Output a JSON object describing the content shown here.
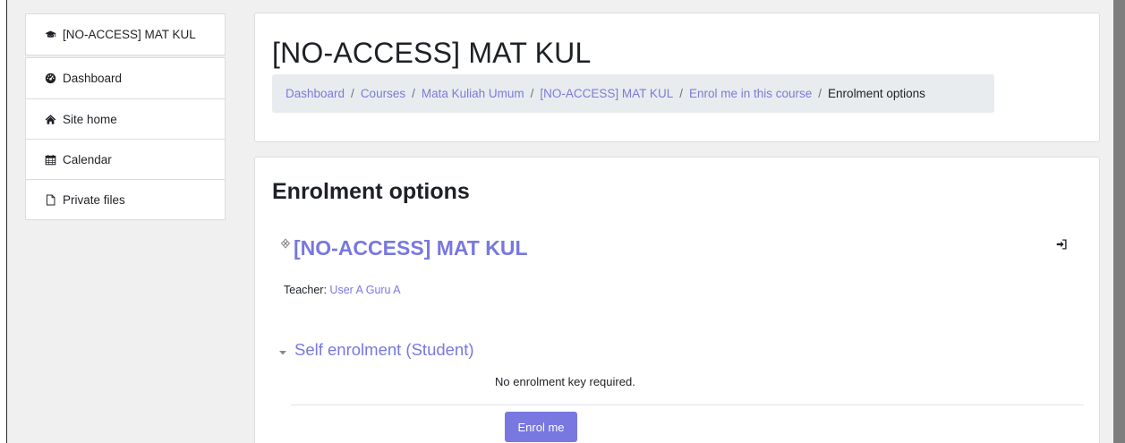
{
  "sidebar": {
    "course_link": {
      "label": "[NO-ACCESS] MAT KUL",
      "icon": "graduation-cap-icon"
    },
    "items": [
      {
        "label": "Dashboard",
        "icon": "tachometer-icon"
      },
      {
        "label": "Site home",
        "icon": "home-icon"
      },
      {
        "label": "Calendar",
        "icon": "calendar-icon"
      },
      {
        "label": "Private files",
        "icon": "file-icon"
      }
    ]
  },
  "header": {
    "title": "[NO-ACCESS] MAT KUL",
    "breadcrumb": [
      {
        "label": "Dashboard",
        "link": true
      },
      {
        "label": "Courses",
        "link": true
      },
      {
        "label": "Mata Kuliah Umum",
        "link": true
      },
      {
        "label": "[NO-ACCESS] MAT KUL",
        "link": true
      },
      {
        "label": "Enrol me in this course",
        "link": true
      },
      {
        "label": "Enrolment options",
        "link": false
      }
    ],
    "separator": "/"
  },
  "content": {
    "heading": "Enrolment options",
    "course_name": "[NO-ACCESS] MAT KUL",
    "teacher_label": "Teacher: ",
    "teacher_name": "User A Guru A",
    "self_enrolment_title": "Self enrolment (Student)",
    "no_key_text": "No enrolment key required.",
    "enrol_button": "Enrol me"
  },
  "colors": {
    "accent": "#7878e0",
    "link": "#7b7bd6",
    "background": "#f0f0f0",
    "breadcrumb_bg": "#e9ecef"
  }
}
